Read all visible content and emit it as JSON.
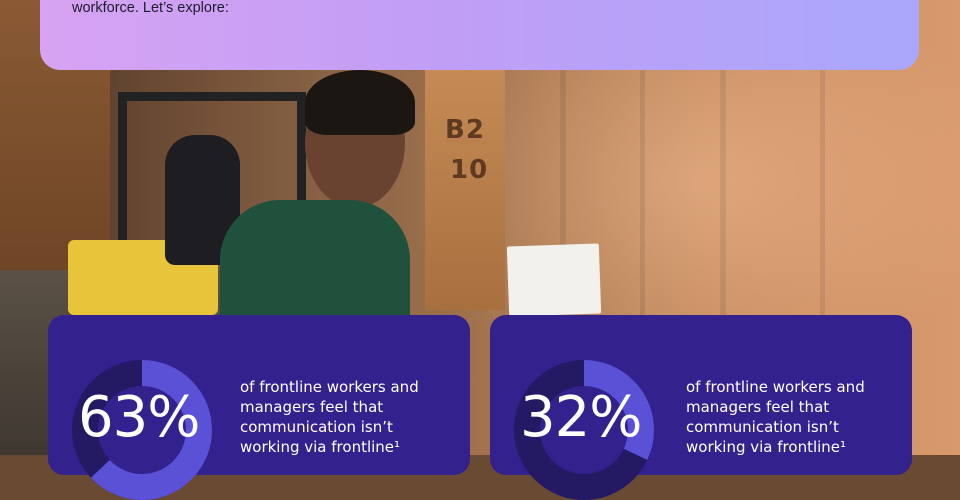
{
  "banner": {
    "text": "workforce. Let’s explore:"
  },
  "stats": [
    {
      "value": "63%",
      "percent": 63,
      "description": "of frontline workers and managers feel that communication isn’t working via frontline¹"
    },
    {
      "value": "32%",
      "percent": 32,
      "description": "of frontline workers and managers feel that communication isn’t working via frontline¹"
    }
  ],
  "photo": {
    "door_label_top": "B2",
    "door_label_bottom": "10"
  },
  "colors": {
    "card": "#33218e",
    "ring_track": "#231a63",
    "ring_fill": "#5a51d6"
  }
}
